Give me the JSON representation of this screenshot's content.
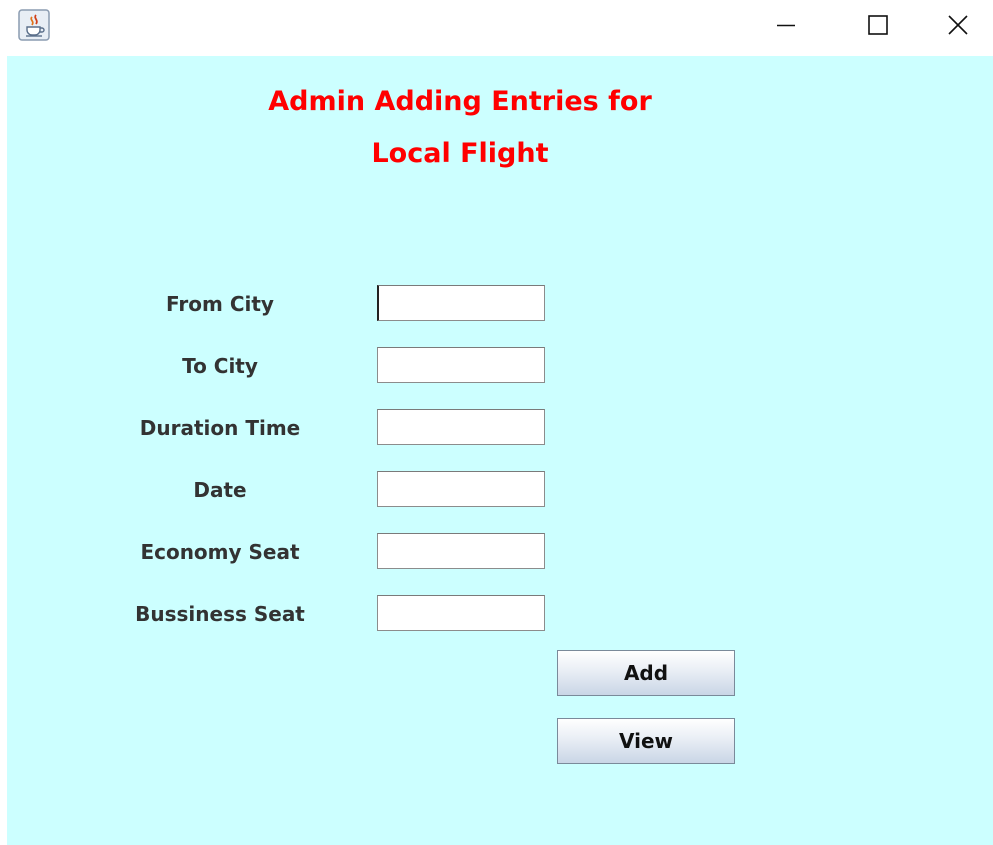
{
  "window": {
    "icon": "java-cup-icon",
    "controls": {
      "minimize": "minimize-icon",
      "maximize": "maximize-icon",
      "close": "close-icon"
    }
  },
  "heading": {
    "line1": "Admin Adding Entries for",
    "line2": "Local Flight"
  },
  "form": {
    "from_city_label": "From City",
    "to_city_label": "To City",
    "duration_time_label": "Duration Time",
    "date_label": "Date",
    "economy_seat_label": "Economy Seat",
    "business_seat_label": "Bussiness Seat",
    "from_city_value": "",
    "to_city_value": "",
    "duration_time_value": "",
    "date_value": "",
    "economy_seat_value": "",
    "business_seat_value": ""
  },
  "buttons": {
    "add_label": "Add",
    "view_label": "View"
  },
  "colors": {
    "background": "#ccffff",
    "heading": "#ff0000",
    "label": "#333333"
  }
}
